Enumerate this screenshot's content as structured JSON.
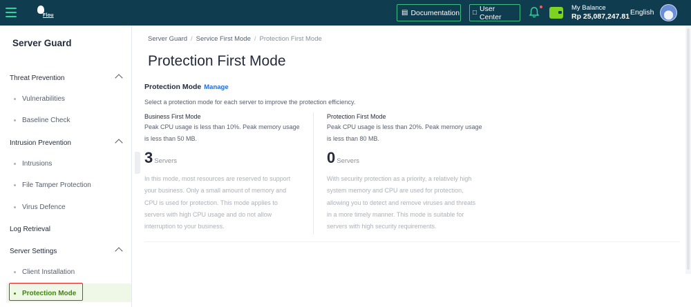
{
  "topbar": {
    "logo_text": "Flou",
    "documentation_label": "Documentation",
    "user_center_label": "User Center",
    "balance_label": "My Balance",
    "balance_value": "Rp 25,087,247.81",
    "language": "English",
    "accent_color": "#34d39a",
    "bg_color": "#103c4f"
  },
  "sidebar": {
    "title": "Server Guard",
    "groups": [
      {
        "label": "Threat Prevention",
        "items": [
          "Vulnerabilities",
          "Baseline Check"
        ]
      },
      {
        "label": "Intrusion Prevention",
        "items": [
          "Intrusions",
          "File Tamper Protection",
          "Virus Defence"
        ]
      },
      {
        "label": "Log Retrieval",
        "items": []
      },
      {
        "label": "Server Settings",
        "items": [
          "Client Installation",
          "Protection Mode"
        ]
      }
    ],
    "active_item": "Protection Mode"
  },
  "breadcrumb": [
    "Server Guard",
    "Service First Mode",
    "Protection First Mode"
  ],
  "main": {
    "title": "Protection First Mode",
    "section_title": "Protection Mode",
    "manage_label": "Manage",
    "description": "Select a protection mode for each server to improve the protection efficiency.",
    "modes": [
      {
        "name": "Business First Mode",
        "limit_line1": "Peak CPU usage is less than 10%. Peak memory usage",
        "limit_line2": "is less than 50 MB.",
        "count": "3",
        "unit": "Servers",
        "desc": [
          "In this mode, most resources are reserved to support",
          "your business. Only a small amount of memory and",
          "CPU is used for protection. This mode applies to",
          "servers with high CPU usage and do not allow",
          "interruption to your business."
        ]
      },
      {
        "name": "Protection First Mode",
        "limit_line1": "Peak CPU usage is less than 20%. Peak memory usage",
        "limit_line2": "is less than 80 MB.",
        "count": "0",
        "unit": "Servers",
        "desc": [
          "With security protection as a priority, a relatively high",
          "system memory and CPU are used for protection,",
          "allowing you to detect and remove viruses and threats",
          "in a more timely manner. This mode is suitable for",
          "servers with high security requirements."
        ]
      }
    ]
  }
}
